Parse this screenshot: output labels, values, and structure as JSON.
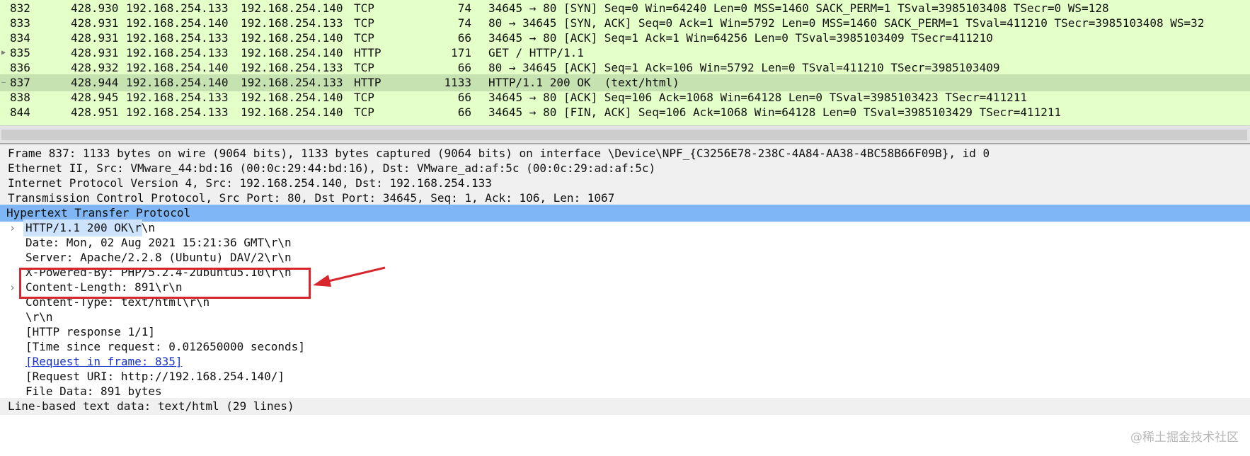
{
  "packets": [
    {
      "no": "832",
      "time": "428.930",
      "src": "192.168.254.133",
      "dst": "192.168.254.140",
      "proto": "TCP",
      "len": "74",
      "info": "34645 → 80 [SYN] Seq=0 Win=64240 Len=0 MSS=1460 SACK_PERM=1 TSval=3985103408 TSecr=0 WS=128"
    },
    {
      "no": "833",
      "time": "428.931",
      "src": "192.168.254.140",
      "dst": "192.168.254.133",
      "proto": "TCP",
      "len": "74",
      "info": "80 → 34645 [SYN, ACK] Seq=0 Ack=1 Win=5792 Len=0 MSS=1460 SACK_PERM=1 TSval=411210 TSecr=3985103408 WS=32"
    },
    {
      "no": "834",
      "time": "428.931",
      "src": "192.168.254.133",
      "dst": "192.168.254.140",
      "proto": "TCP",
      "len": "66",
      "info": "34645 → 80 [ACK] Seq=1 Ack=1 Win=64256 Len=0 TSval=3985103409 TSecr=411210"
    },
    {
      "no": "835",
      "time": "428.931",
      "src": "192.168.254.133",
      "dst": "192.168.254.140",
      "proto": "HTTP",
      "len": "171",
      "info": "GET / HTTP/1.1"
    },
    {
      "no": "836",
      "time": "428.932",
      "src": "192.168.254.140",
      "dst": "192.168.254.133",
      "proto": "TCP",
      "len": "66",
      "info": "80 → 34645 [ACK] Seq=1 Ack=106 Win=5792 Len=0 TSval=411210 TSecr=3985103409"
    },
    {
      "no": "837",
      "time": "428.944",
      "src": "192.168.254.140",
      "dst": "192.168.254.133",
      "proto": "HTTP",
      "len": "1133",
      "info": "HTTP/1.1 200 OK  (text/html)"
    },
    {
      "no": "838",
      "time": "428.945",
      "src": "192.168.254.133",
      "dst": "192.168.254.140",
      "proto": "TCP",
      "len": "66",
      "info": "34645 → 80 [ACK] Seq=106 Ack=1068 Win=64128 Len=0 TSval=3985103423 TSecr=411211"
    },
    {
      "no": "844",
      "time": "428.951",
      "src": "192.168.254.133",
      "dst": "192.168.254.140",
      "proto": "TCP",
      "len": "66",
      "info": "34645 → 80 [FIN, ACK] Seq=106 Ack=1068 Win=64128 Len=0 TSval=3985103429 TSecr=411211"
    }
  ],
  "selected_packet": "837",
  "details": {
    "frame": "Frame 837: 1133 bytes on wire (9064 bits), 1133 bytes captured (9064 bits) on interface \\Device\\NPF_{C3256E78-238C-4A84-AA38-4BC58B66F09B}, id 0",
    "ethernet": "Ethernet II, Src: VMware_44:bd:16 (00:0c:29:44:bd:16), Dst: VMware_ad:af:5c (00:0c:29:ad:af:5c)",
    "ip": "Internet Protocol Version 4, Src: 192.168.254.140, Dst: 192.168.254.133",
    "tcp": "Transmission Control Protocol, Src Port: 80, Dst Port: 34645, Seq: 1, Ack: 106, Len: 1067",
    "http": "Hypertext Transfer Protocol",
    "http_status": "HTTP/1.1 200 OK\\r\\n",
    "date": "Date: Mon, 02 Aug 2021 15:21:36 GMT\\r\\n",
    "server": "Server: Apache/2.2.8 (Ubuntu) DAV/2\\r\\n",
    "powered_by": "X-Powered-By: PHP/5.2.4-2ubuntu5.10\\r\\n",
    "content_length": "Content-Length: 891\\r\\n",
    "content_type": "Content-Type: text/html\\r\\n",
    "crlf": "\\r\\n",
    "response_num": "[HTTP response 1/1]",
    "time_since": "[Time since request: 0.012650000 seconds]",
    "request_in_frame": "[Request in frame: 835]",
    "request_uri": "[Request URI: http://192.168.254.140/]",
    "file_data": "File Data: 891 bytes",
    "line_based": "Line-based text data: text/html (29 lines)"
  },
  "icons": {
    "expand": "chevron-right-icon",
    "annotation": "red-arrow-icon"
  },
  "colors": {
    "packet_bg": "#e4ffc7",
    "selected_bg": "#c6e2b0",
    "highlight": "#7fb6f5",
    "annotation": "#d9262e"
  },
  "watermark": "@稀土掘金技术社区"
}
